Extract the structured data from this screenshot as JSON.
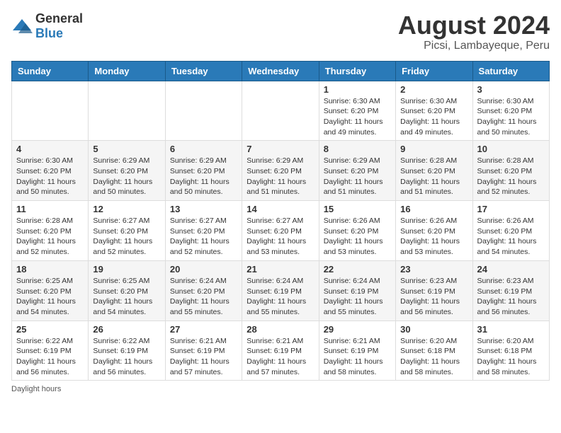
{
  "logo": {
    "general": "General",
    "blue": "Blue"
  },
  "title": "August 2024",
  "subtitle": "Picsi, Lambayeque, Peru",
  "days_of_week": [
    "Sunday",
    "Monday",
    "Tuesday",
    "Wednesday",
    "Thursday",
    "Friday",
    "Saturday"
  ],
  "footer": "Daylight hours",
  "weeks": [
    [
      {
        "day": "",
        "info": ""
      },
      {
        "day": "",
        "info": ""
      },
      {
        "day": "",
        "info": ""
      },
      {
        "day": "",
        "info": ""
      },
      {
        "day": "1",
        "info": "Sunrise: 6:30 AM\nSunset: 6:20 PM\nDaylight: 11 hours and 49 minutes."
      },
      {
        "day": "2",
        "info": "Sunrise: 6:30 AM\nSunset: 6:20 PM\nDaylight: 11 hours and 49 minutes."
      },
      {
        "day": "3",
        "info": "Sunrise: 6:30 AM\nSunset: 6:20 PM\nDaylight: 11 hours and 50 minutes."
      }
    ],
    [
      {
        "day": "4",
        "info": "Sunrise: 6:30 AM\nSunset: 6:20 PM\nDaylight: 11 hours and 50 minutes."
      },
      {
        "day": "5",
        "info": "Sunrise: 6:29 AM\nSunset: 6:20 PM\nDaylight: 11 hours and 50 minutes."
      },
      {
        "day": "6",
        "info": "Sunrise: 6:29 AM\nSunset: 6:20 PM\nDaylight: 11 hours and 50 minutes."
      },
      {
        "day": "7",
        "info": "Sunrise: 6:29 AM\nSunset: 6:20 PM\nDaylight: 11 hours and 51 minutes."
      },
      {
        "day": "8",
        "info": "Sunrise: 6:29 AM\nSunset: 6:20 PM\nDaylight: 11 hours and 51 minutes."
      },
      {
        "day": "9",
        "info": "Sunrise: 6:28 AM\nSunset: 6:20 PM\nDaylight: 11 hours and 51 minutes."
      },
      {
        "day": "10",
        "info": "Sunrise: 6:28 AM\nSunset: 6:20 PM\nDaylight: 11 hours and 52 minutes."
      }
    ],
    [
      {
        "day": "11",
        "info": "Sunrise: 6:28 AM\nSunset: 6:20 PM\nDaylight: 11 hours and 52 minutes."
      },
      {
        "day": "12",
        "info": "Sunrise: 6:27 AM\nSunset: 6:20 PM\nDaylight: 11 hours and 52 minutes."
      },
      {
        "day": "13",
        "info": "Sunrise: 6:27 AM\nSunset: 6:20 PM\nDaylight: 11 hours and 52 minutes."
      },
      {
        "day": "14",
        "info": "Sunrise: 6:27 AM\nSunset: 6:20 PM\nDaylight: 11 hours and 53 minutes."
      },
      {
        "day": "15",
        "info": "Sunrise: 6:26 AM\nSunset: 6:20 PM\nDaylight: 11 hours and 53 minutes."
      },
      {
        "day": "16",
        "info": "Sunrise: 6:26 AM\nSunset: 6:20 PM\nDaylight: 11 hours and 53 minutes."
      },
      {
        "day": "17",
        "info": "Sunrise: 6:26 AM\nSunset: 6:20 PM\nDaylight: 11 hours and 54 minutes."
      }
    ],
    [
      {
        "day": "18",
        "info": "Sunrise: 6:25 AM\nSunset: 6:20 PM\nDaylight: 11 hours and 54 minutes."
      },
      {
        "day": "19",
        "info": "Sunrise: 6:25 AM\nSunset: 6:20 PM\nDaylight: 11 hours and 54 minutes."
      },
      {
        "day": "20",
        "info": "Sunrise: 6:24 AM\nSunset: 6:20 PM\nDaylight: 11 hours and 55 minutes."
      },
      {
        "day": "21",
        "info": "Sunrise: 6:24 AM\nSunset: 6:19 PM\nDaylight: 11 hours and 55 minutes."
      },
      {
        "day": "22",
        "info": "Sunrise: 6:24 AM\nSunset: 6:19 PM\nDaylight: 11 hours and 55 minutes."
      },
      {
        "day": "23",
        "info": "Sunrise: 6:23 AM\nSunset: 6:19 PM\nDaylight: 11 hours and 56 minutes."
      },
      {
        "day": "24",
        "info": "Sunrise: 6:23 AM\nSunset: 6:19 PM\nDaylight: 11 hours and 56 minutes."
      }
    ],
    [
      {
        "day": "25",
        "info": "Sunrise: 6:22 AM\nSunset: 6:19 PM\nDaylight: 11 hours and 56 minutes."
      },
      {
        "day": "26",
        "info": "Sunrise: 6:22 AM\nSunset: 6:19 PM\nDaylight: 11 hours and 56 minutes."
      },
      {
        "day": "27",
        "info": "Sunrise: 6:21 AM\nSunset: 6:19 PM\nDaylight: 11 hours and 57 minutes."
      },
      {
        "day": "28",
        "info": "Sunrise: 6:21 AM\nSunset: 6:19 PM\nDaylight: 11 hours and 57 minutes."
      },
      {
        "day": "29",
        "info": "Sunrise: 6:21 AM\nSunset: 6:19 PM\nDaylight: 11 hours and 58 minutes."
      },
      {
        "day": "30",
        "info": "Sunrise: 6:20 AM\nSunset: 6:18 PM\nDaylight: 11 hours and 58 minutes."
      },
      {
        "day": "31",
        "info": "Sunrise: 6:20 AM\nSunset: 6:18 PM\nDaylight: 11 hours and 58 minutes."
      }
    ]
  ]
}
